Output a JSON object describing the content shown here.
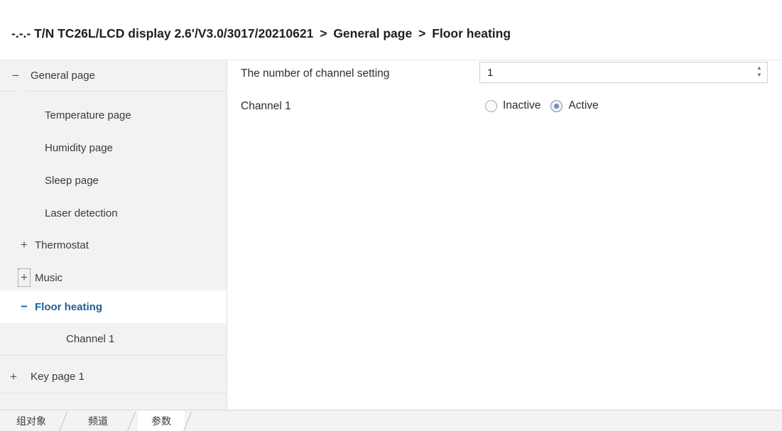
{
  "header": {
    "breadcrumb": [
      "-.-.- T/N TC26L/LCD display 2.6'/V3.0/3017/20210621",
      "General page",
      "Floor heating"
    ],
    "separator": ">"
  },
  "sidebar": {
    "items": [
      {
        "label": "General page",
        "toggle": "−"
      },
      {
        "label": "Temperature page",
        "toggle": ""
      },
      {
        "label": "Humidity page",
        "toggle": ""
      },
      {
        "label": "Sleep page",
        "toggle": ""
      },
      {
        "label": "Laser detection",
        "toggle": ""
      },
      {
        "label": "Thermostat",
        "toggle": "+"
      },
      {
        "label": "Music",
        "toggle": "+"
      },
      {
        "label": "Floor heating",
        "toggle": "−",
        "selected": true
      },
      {
        "label": "Channel 1",
        "toggle": ""
      },
      {
        "label": "Key page 1",
        "toggle": "+"
      }
    ]
  },
  "main": {
    "channel_count_label": "The number of channel setting",
    "channel_count_value": "1",
    "channel1_label": "Channel 1",
    "options": [
      {
        "label": "Inactive",
        "checked": false
      },
      {
        "label": "Active",
        "checked": true
      }
    ]
  },
  "tabs": [
    {
      "label": "组对象"
    },
    {
      "label": "频道"
    },
    {
      "label": "参数"
    }
  ],
  "colors": {
    "selected_text": "#1e5f96",
    "sidebar_bg": "#f2f2f2",
    "radio_dot": "#6f8fb8"
  },
  "icons": {
    "spin_up": "up-arrow-icon",
    "spin_down": "down-arrow-icon",
    "collapse": "minus-icon",
    "expand": "plus-icon"
  }
}
